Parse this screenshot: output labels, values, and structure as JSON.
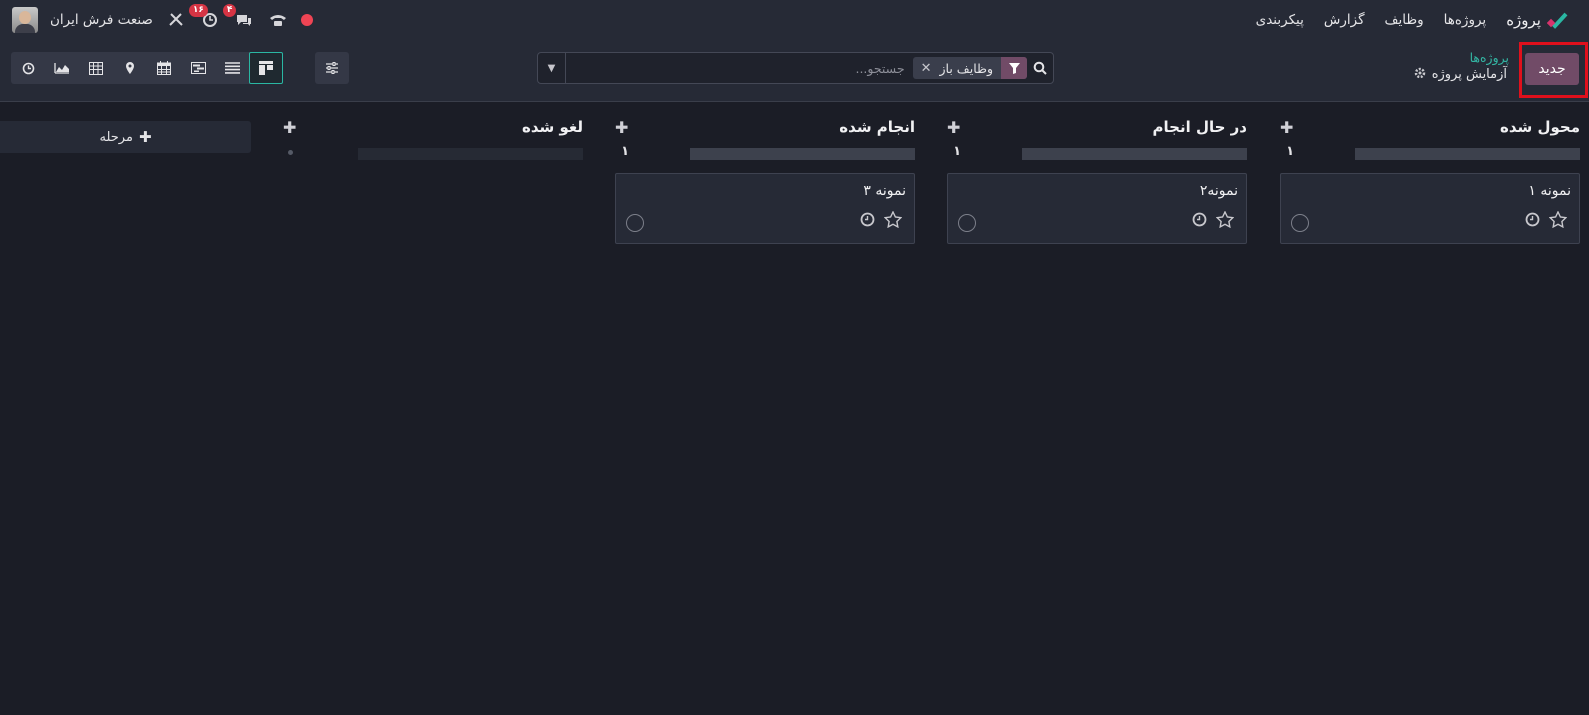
{
  "navbar": {
    "brand": "پروژه",
    "menu": [
      "پروژه‌ها",
      "وظایف",
      "گزارش",
      "پیکربندی"
    ],
    "messages_badge": "۴",
    "activities_badge": "۱۶",
    "company": "صنعت فرش ایران"
  },
  "control": {
    "new_button": "جدید",
    "breadcrumb_parent": "پروژه‌ها",
    "breadcrumb_current": "آزمایش پروژه",
    "search_facet": "وظایف باز",
    "search_placeholder": "جستجو..."
  },
  "views": [
    "kanban",
    "list",
    "gantt",
    "calendar",
    "map",
    "pivot",
    "graph",
    "activity"
  ],
  "stages": [
    {
      "title": "محول شده",
      "count": "۱",
      "card": "نمونه ۱"
    },
    {
      "title": "در حال انجام",
      "count": "۱",
      "card": "نمونه۲"
    },
    {
      "title": "انجام شده",
      "count": "۱",
      "card": "نمونه ۳"
    },
    {
      "title": "لغو شده",
      "count": ""
    }
  ],
  "add_stage_label": "مرحله",
  "colors": {
    "accent": "#714b67",
    "teal": "#2ab7a3",
    "highlight": "#e0101c"
  }
}
